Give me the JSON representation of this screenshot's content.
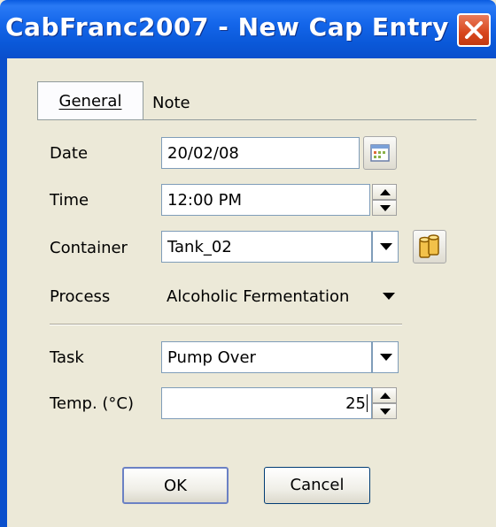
{
  "window": {
    "title": "CabFranc2007 - New Cap Entry"
  },
  "tabs": [
    {
      "label": "General",
      "active": true
    },
    {
      "label": "Note",
      "active": false
    }
  ],
  "form": {
    "date": {
      "label": "Date",
      "value": "20/02/08"
    },
    "time": {
      "label": "Time",
      "value": "12:00 PM"
    },
    "container": {
      "label": "Container",
      "value": "Tank_02"
    },
    "process": {
      "label": "Process",
      "value": "Alcoholic Fermentation"
    },
    "task": {
      "label": "Task",
      "value": "Pump Over"
    },
    "temp": {
      "label": "Temp. (°C)",
      "value": "25"
    }
  },
  "buttons": {
    "ok": "OK",
    "cancel": "Cancel"
  },
  "colors": {
    "titlebar": "#0a58d8",
    "close": "#d8461c",
    "client": "#ece9d8",
    "field_border": "#7f9db9"
  }
}
